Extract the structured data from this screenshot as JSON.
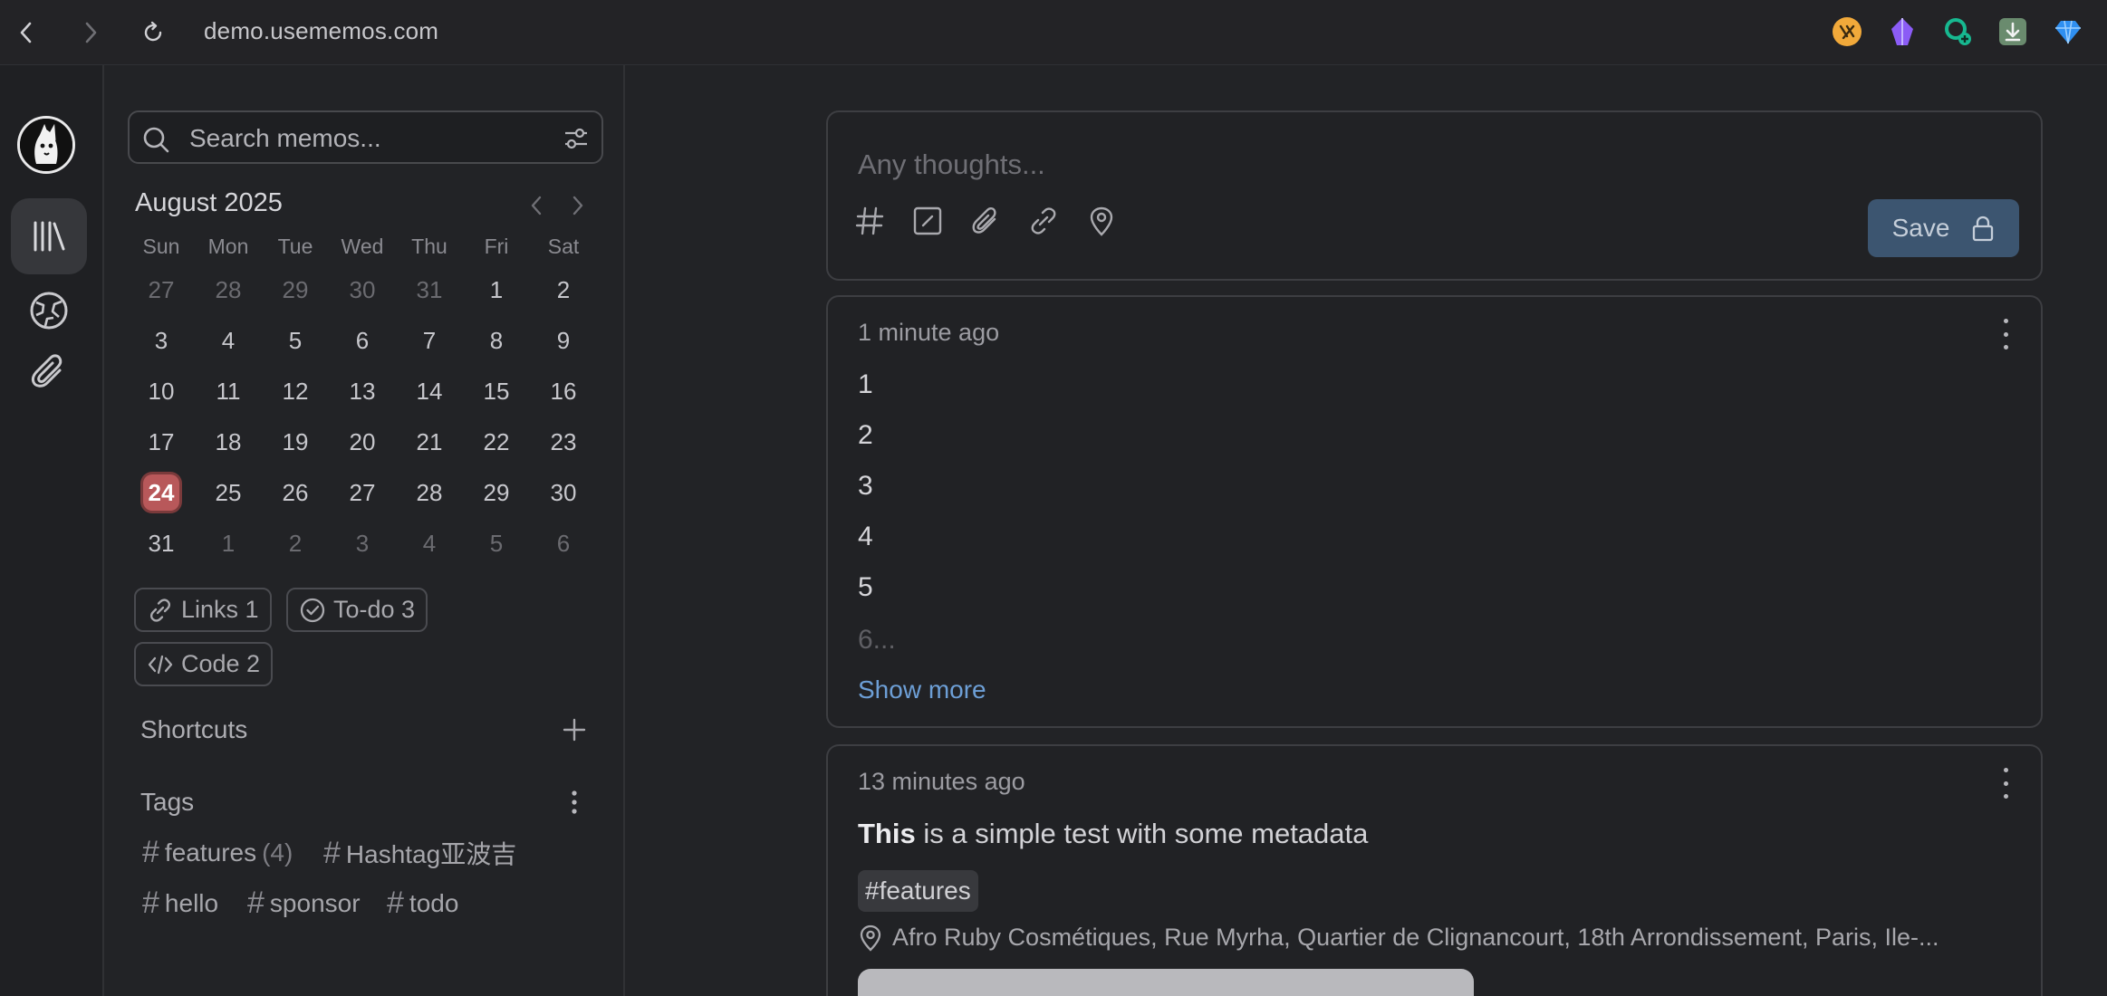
{
  "browser": {
    "url": "demo.usememos.com",
    "extensions": [
      "ext-yellow-icon",
      "ext-purple-icon",
      "ext-green-icon",
      "ext-download-icon",
      "ext-diamond-icon"
    ]
  },
  "search": {
    "placeholder": "Search memos..."
  },
  "calendar": {
    "title": "August 2025",
    "weekdays": [
      "Sun",
      "Mon",
      "Tue",
      "Wed",
      "Thu",
      "Fri",
      "Sat"
    ],
    "weeks": [
      [
        "27",
        "28",
        "29",
        "30",
        "31",
        "1",
        "2"
      ],
      [
        "3",
        "4",
        "5",
        "6",
        "7",
        "8",
        "9"
      ],
      [
        "10",
        "11",
        "12",
        "13",
        "14",
        "15",
        "16"
      ],
      [
        "17",
        "18",
        "19",
        "20",
        "21",
        "22",
        "23"
      ],
      [
        "24",
        "25",
        "26",
        "27",
        "28",
        "29",
        "30"
      ],
      [
        "31",
        "1",
        "2",
        "3",
        "4",
        "5",
        "6"
      ]
    ],
    "today": "24"
  },
  "filters": {
    "links": "Links 1",
    "todo": "To-do 3",
    "code": "Code 2"
  },
  "shortcuts": {
    "title": "Shortcuts"
  },
  "tags": {
    "title": "Tags",
    "items": [
      {
        "name": "features",
        "count": "(4)"
      },
      {
        "name": "Hashtag亚波吉",
        "count": ""
      },
      {
        "name": "hello",
        "count": ""
      },
      {
        "name": "sponsor",
        "count": ""
      },
      {
        "name": "todo",
        "count": ""
      }
    ]
  },
  "editor": {
    "placeholder": "Any thoughts...",
    "save_label": "Save"
  },
  "memos": [
    {
      "time": "1 minute ago",
      "lines": [
        "1",
        "2",
        "3",
        "4",
        "5"
      ],
      "faded": "6...",
      "show_more": "Show more"
    },
    {
      "time": "13 minutes ago",
      "bold": "This",
      "text": " is a simple test with some metadata",
      "tag": "#features",
      "location": "Afro Ruby Cosmétiques, Rue Myrha, Quartier de Clignancourt, 18th Arrondissement, Paris, Ile-..."
    }
  ],
  "colors": {
    "accent": "#b8585a",
    "save_button": "#3c5570",
    "link": "#6d9fd6"
  }
}
